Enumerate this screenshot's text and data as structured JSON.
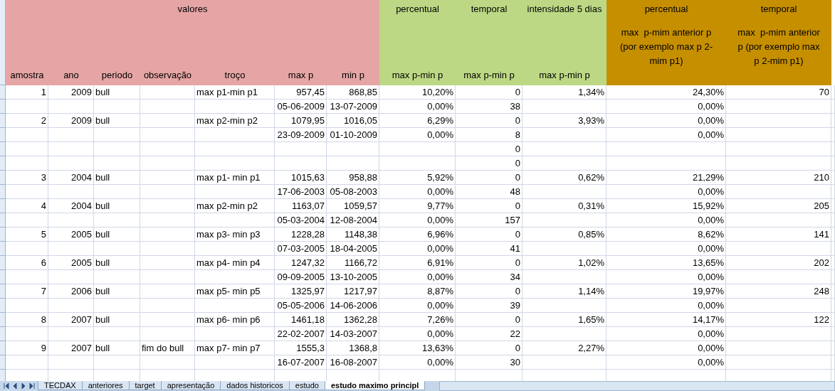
{
  "groups": [
    {
      "label": "valores",
      "color": "#e6a5a5"
    },
    {
      "label": "percentual",
      "color": "#bcd884"
    },
    {
      "label": "temporal",
      "color": "#bcd884"
    },
    {
      "label": "intensidade 5 dias",
      "color": "#bcd884"
    },
    {
      "label": "percentual",
      "color": "#c68f00"
    },
    {
      "label": "temporal",
      "color": "#c68f00"
    }
  ],
  "columns": [
    "amostra",
    "ano",
    "periodo",
    "observação",
    "troço",
    "max p",
    "min p",
    "max p-min p",
    "max p-min p",
    "max p-min p",
    "max  p-mim anterior p (por exemplo max p 2-mim p1)",
    "max  p-mim anterior p (por exemplo max p 2-mim p1)"
  ],
  "rows": [
    [
      "1",
      "2009",
      "bull",
      "",
      "max p1-min p1",
      "957,45",
      "868,85",
      "10,20%",
      "0",
      "1,34%",
      "24,30%",
      "70"
    ],
    [
      "",
      "",
      "",
      "",
      "",
      "05-06-2009",
      "13-07-2009",
      "0,00%",
      "38",
      "",
      "0,00%",
      ""
    ],
    [
      "2",
      "2009",
      "bull",
      "",
      "max p2-min p2",
      "1079,95",
      "1016,05",
      "6,29%",
      "0",
      "3,93%",
      "0,00%",
      ""
    ],
    [
      "",
      "",
      "",
      "",
      "",
      "23-09-2009",
      "01-10-2009",
      "0,00%",
      "8",
      "",
      "0,00%",
      ""
    ],
    [
      "",
      "",
      "",
      "",
      "",
      "",
      "",
      "",
      "0",
      "",
      "",
      ""
    ],
    [
      "",
      "",
      "",
      "",
      "",
      "",
      "",
      "",
      "0",
      "",
      "",
      ""
    ],
    [
      "3",
      "2004",
      "bull",
      "",
      "max p1- min p1",
      "1015,63",
      "958,88",
      "5,92%",
      "0",
      "0,62%",
      "21,29%",
      "210"
    ],
    [
      "",
      "",
      "",
      "",
      "",
      "17-06-2003",
      "05-08-2003",
      "0,00%",
      "48",
      "",
      "0,00%",
      ""
    ],
    [
      "4",
      "2004",
      "bull",
      "",
      "max p2-min p2",
      "1163,07",
      "1059,57",
      "9,77%",
      "0",
      "0,31%",
      "15,92%",
      "205"
    ],
    [
      "",
      "",
      "",
      "",
      "",
      "05-03-2004",
      "12-08-2004",
      "0,00%",
      "157",
      "",
      "0,00%",
      ""
    ],
    [
      "5",
      "2005",
      "bull",
      "",
      "max p3- min p3",
      "1228,28",
      "1148,38",
      "6,96%",
      "0",
      "0,85%",
      "8,62%",
      "141"
    ],
    [
      "",
      "",
      "",
      "",
      "",
      "07-03-2005",
      "18-04-2005",
      "0,00%",
      "41",
      "",
      "0,00%",
      ""
    ],
    [
      "6",
      "2005",
      "bull",
      "",
      "max p4- min p4",
      "1247,32",
      "1166,72",
      "6,91%",
      "0",
      "1,02%",
      "13,65%",
      "202"
    ],
    [
      "",
      "",
      "",
      "",
      "",
      "09-09-2005",
      "13-10-2005",
      "0,00%",
      "34",
      "",
      "0,00%",
      ""
    ],
    [
      "7",
      "2006",
      "bull",
      "",
      "max p5- min p5",
      "1325,97",
      "1217,97",
      "8,87%",
      "0",
      "1,14%",
      "19,97%",
      "248"
    ],
    [
      "",
      "",
      "",
      "",
      "",
      "05-05-2006",
      "14-06-2006",
      "0,00%",
      "39",
      "",
      "0,00%",
      ""
    ],
    [
      "8",
      "2007",
      "bull",
      "",
      "max p6- min p6",
      "1461,18",
      "1362,28",
      "7,26%",
      "0",
      "1,65%",
      "14,17%",
      "122"
    ],
    [
      "",
      "",
      "",
      "",
      "",
      "22-02-2007",
      "14-03-2007",
      "0,00%",
      "22",
      "",
      "0,00%",
      ""
    ],
    [
      "9",
      "2007",
      "bull",
      "fim do bull",
      "max p7- min p7",
      "1555,3",
      "1368,8",
      "13,63%",
      "0",
      "2,27%",
      "0,00%",
      ""
    ],
    [
      "",
      "",
      "",
      "",
      "",
      "16-07-2007",
      "16-08-2007",
      "0,00%",
      "30",
      "",
      "0,00%",
      ""
    ]
  ],
  "sheet_tabs": [
    {
      "label": "TECDAX",
      "selected": false
    },
    {
      "label": "anteriores",
      "selected": false
    },
    {
      "label": "target",
      "selected": false
    },
    {
      "label": "apresentação",
      "selected": false
    },
    {
      "label": "dados historicos",
      "selected": false
    },
    {
      "label": "estudo",
      "selected": false
    },
    {
      "label": "estudo maximo principl",
      "selected": true
    }
  ]
}
